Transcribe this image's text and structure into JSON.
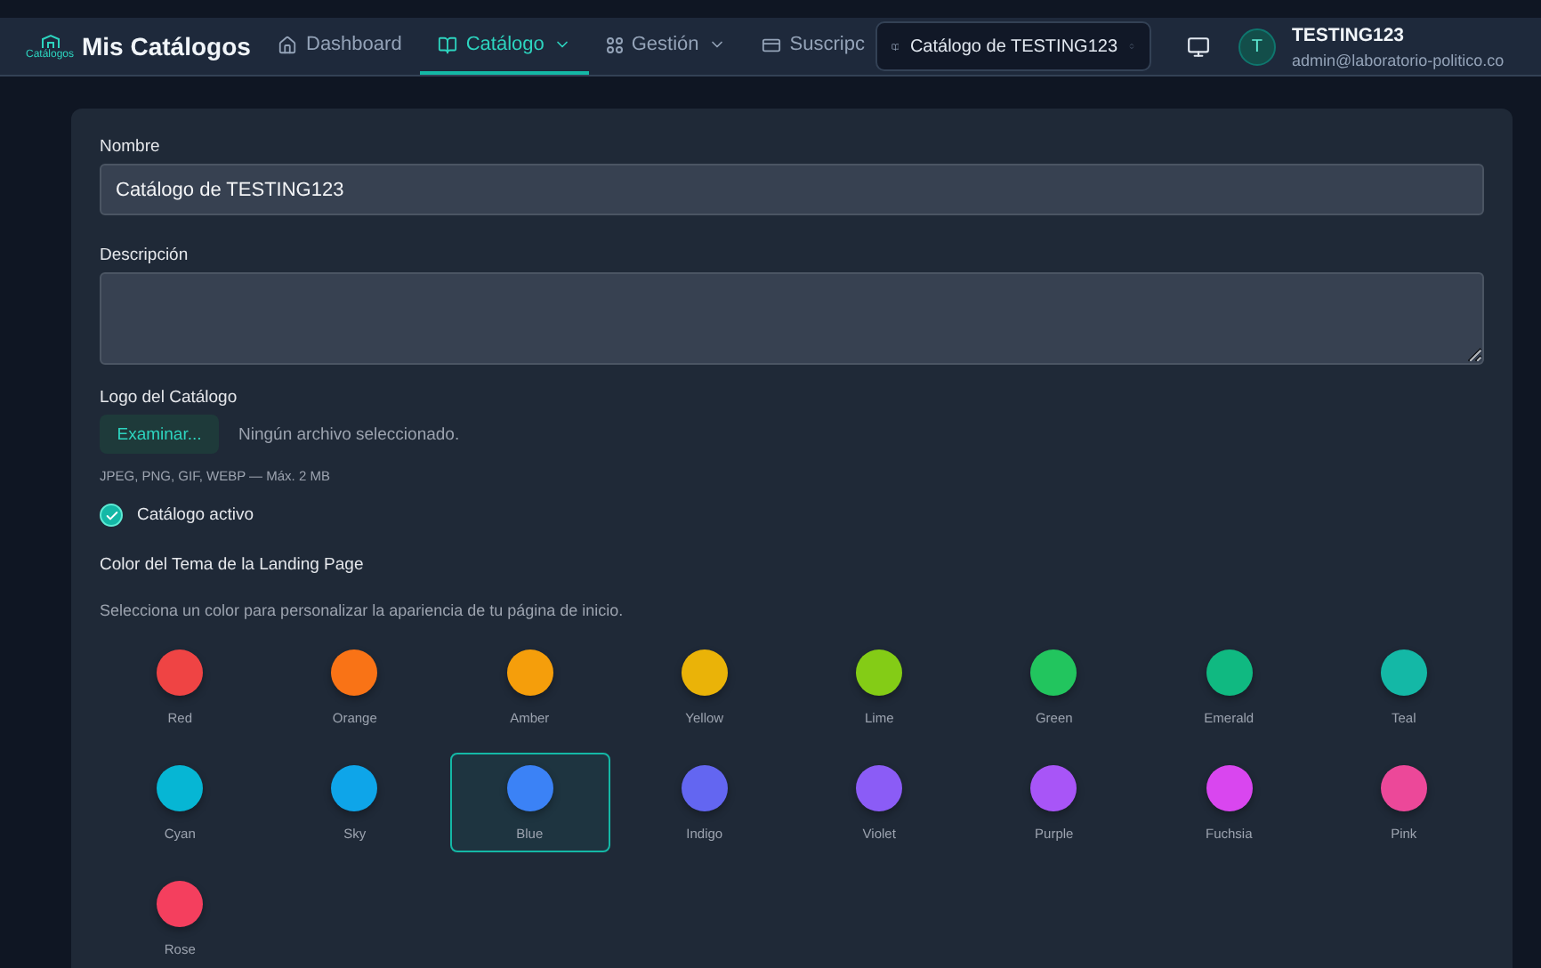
{
  "brand": {
    "logo_caption": "Catálogos",
    "title": "Mis Catálogos"
  },
  "nav": [
    {
      "kind": "home",
      "label": "Dashboard",
      "selected": false,
      "dropdown": false
    },
    {
      "kind": "book",
      "label": "Catálogo",
      "selected": true,
      "dropdown": true
    },
    {
      "kind": "grid",
      "label": "Gestión",
      "selected": false,
      "dropdown": true
    },
    {
      "kind": "card",
      "label": "Suscripc",
      "selected": false,
      "dropdown": false
    }
  ],
  "catalog_selector": {
    "label": "Catálogo de TESTING123"
  },
  "user": {
    "initial": "T",
    "name": "TESTING123",
    "email": "admin@laboratorio-politico.co"
  },
  "form": {
    "name_label": "Nombre",
    "name_value": "Catálogo de TESTING123",
    "description_label": "Descripción",
    "logo_label": "Logo del Catálogo",
    "browse_button": "Examinar...",
    "file_status": "Ningún archivo seleccionado.",
    "file_hint": "JPEG, PNG, GIF, WEBP — Máx. 2 MB",
    "active": {
      "label": "Catálogo activo",
      "checked": true
    },
    "theme_title": "Color del Tema de la Landing Page",
    "theme_description": "Selecciona un color para personalizar la apariencia de tu página de inicio.",
    "colors": [
      {
        "name": "Red",
        "color": "#ef4444",
        "selected": false
      },
      {
        "name": "Orange",
        "color": "#f97316",
        "selected": false
      },
      {
        "name": "Amber",
        "color": "#f59e0b",
        "selected": false
      },
      {
        "name": "Yellow",
        "color": "#eab308",
        "selected": false
      },
      {
        "name": "Lime",
        "color": "#84cc16",
        "selected": false
      },
      {
        "name": "Green",
        "color": "#22c55e",
        "selected": false
      },
      {
        "name": "Emerald",
        "color": "#10b981",
        "selected": false
      },
      {
        "name": "Teal",
        "color": "#14b8a6",
        "selected": false
      },
      {
        "name": "Cyan",
        "color": "#06b6d4",
        "selected": false
      },
      {
        "name": "Sky",
        "color": "#0ea5e9",
        "selected": false
      },
      {
        "name": "Blue",
        "color": "#3b82f6",
        "selected": true
      },
      {
        "name": "Indigo",
        "color": "#6366f1",
        "selected": false
      },
      {
        "name": "Violet",
        "color": "#8b5cf6",
        "selected": false
      },
      {
        "name": "Purple",
        "color": "#a855f7",
        "selected": false
      },
      {
        "name": "Fuchsia",
        "color": "#d946ef",
        "selected": false
      },
      {
        "name": "Pink",
        "color": "#ec4899",
        "selected": false
      },
      {
        "name": "Rose",
        "color": "#f43f5e",
        "selected": false
      }
    ]
  }
}
